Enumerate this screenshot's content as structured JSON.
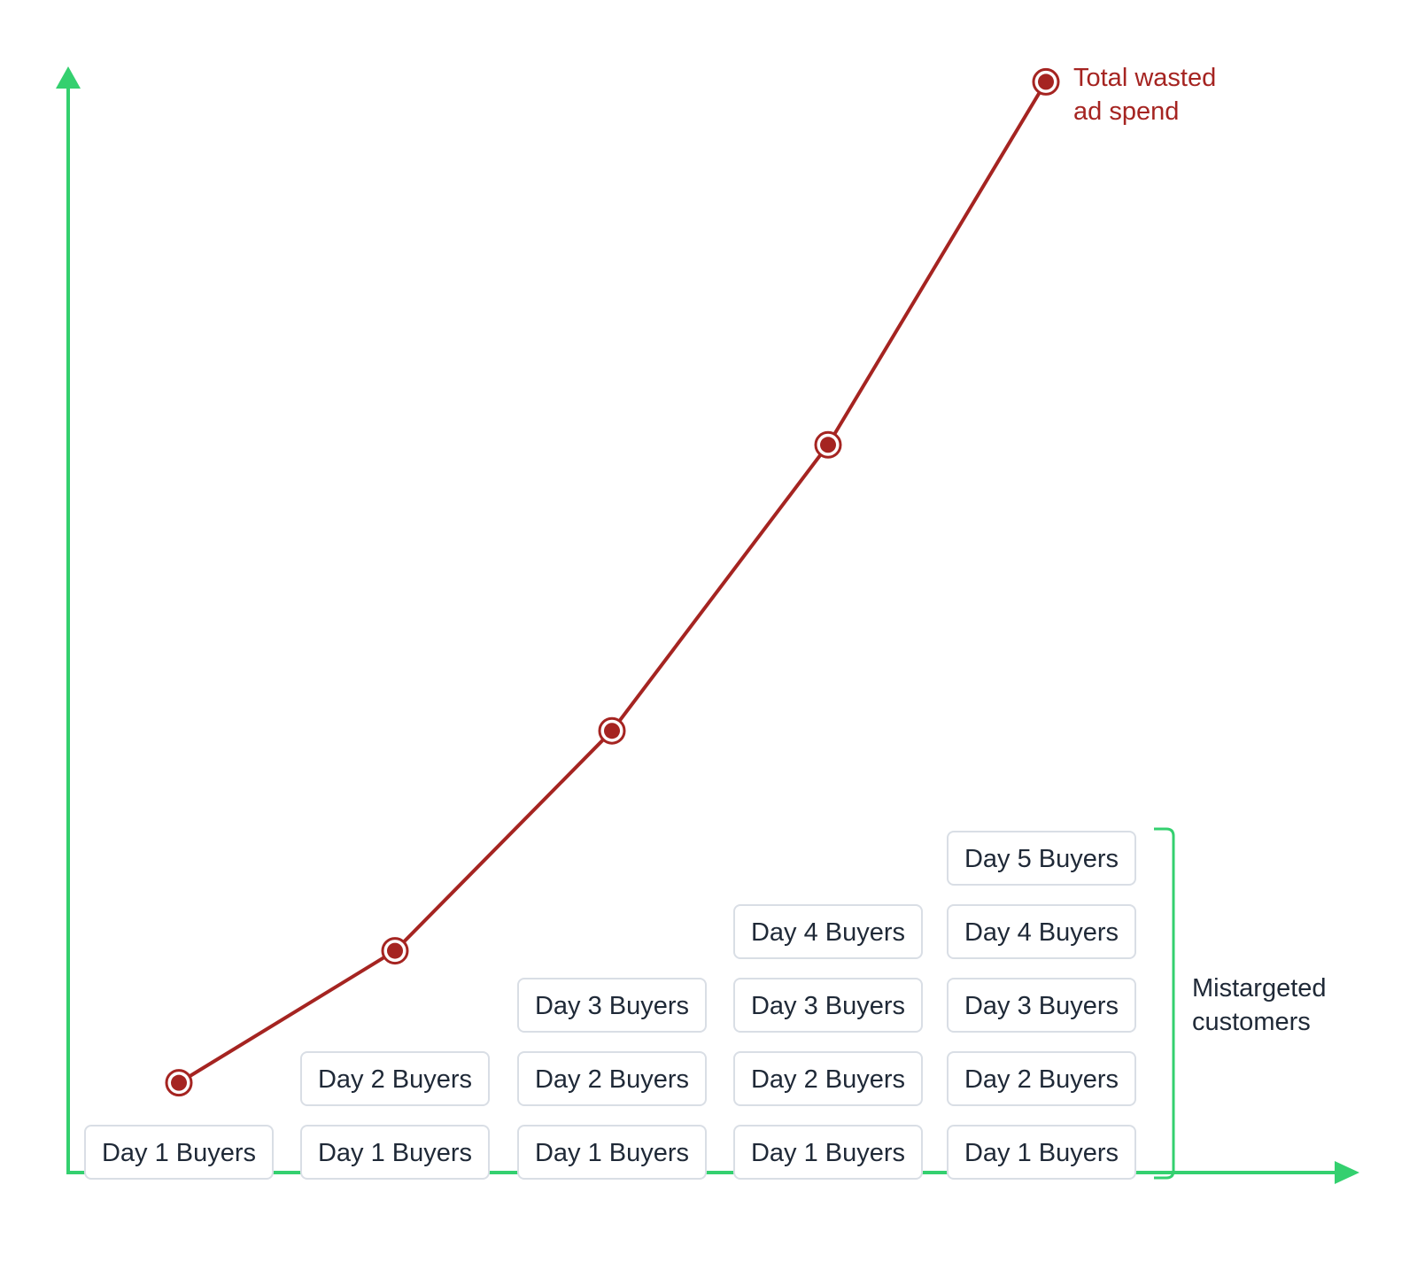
{
  "chart_data": {
    "type": "line",
    "title": "",
    "xlabel": "",
    "ylabel": "",
    "grid": false,
    "x": [
      1,
      2,
      3,
      4,
      5
    ],
    "categories": [
      "Day 1",
      "Day 2",
      "Day 3",
      "Day 4",
      "Day 5"
    ],
    "ylim": [
      0,
      1
    ],
    "series": [
      {
        "name": "Total wasted ad spend",
        "values": [
          0.08,
          0.2,
          0.4,
          0.66,
          0.99
        ],
        "color": "#a52421"
      }
    ],
    "stacks": [
      [
        "Day 1 Buyers"
      ],
      [
        "Day 1 Buyers",
        "Day 2 Buyers"
      ],
      [
        "Day 1 Buyers",
        "Day 2 Buyers",
        "Day 3 Buyers"
      ],
      [
        "Day 1 Buyers",
        "Day 2 Buyers",
        "Day 3 Buyers",
        "Day 4 Buyers"
      ],
      [
        "Day 1 Buyers",
        "Day 2 Buyers",
        "Day 3 Buyers",
        "Day 4 Buyers",
        "Day 5 Buyers"
      ]
    ],
    "annotations": {
      "line_label": [
        "Total wasted",
        "ad spend"
      ],
      "bracket_label": [
        "Mistargeted",
        "customers"
      ]
    },
    "colors": {
      "axis": "#34d06f",
      "line": "#a52421",
      "box_border": "#d9dee5",
      "box_text": "#1f2937",
      "bracket": "#34d06f",
      "bracket_text": "#1f2937"
    }
  }
}
